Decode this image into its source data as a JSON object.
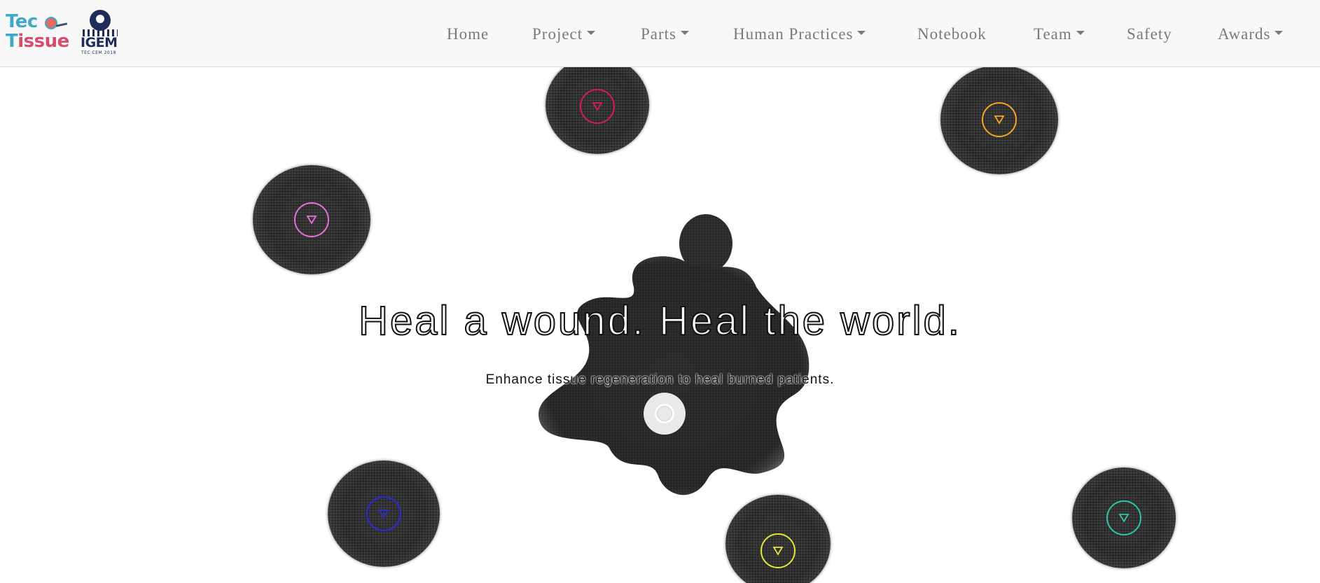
{
  "brand": {
    "teco_line1": "Tec",
    "teco_line2_a": "T",
    "teco_line2_b": "issue",
    "igem_text": "IGEM",
    "igem_sub": "TEC CEM 2018"
  },
  "nav": {
    "items": [
      {
        "label": "Home",
        "dropdown": false
      },
      {
        "label": "Project",
        "dropdown": true
      },
      {
        "label": "Parts",
        "dropdown": true
      },
      {
        "label": "Human Practices",
        "dropdown": true
      },
      {
        "label": "Notebook",
        "dropdown": false
      },
      {
        "label": "Team",
        "dropdown": true
      },
      {
        "label": "Safety",
        "dropdown": false
      },
      {
        "label": "Awards",
        "dropdown": true
      }
    ]
  },
  "hero": {
    "title": "Heal a wound. Heal the world.",
    "subtitle": "Enhance tissue regeneration to heal burned patients."
  },
  "spheres": [
    {
      "name": "sphere-crimson",
      "ring_color": "#d81b60"
    },
    {
      "name": "sphere-orange",
      "ring_color": "#f5a623"
    },
    {
      "name": "sphere-pink",
      "ring_color": "#e573d6"
    },
    {
      "name": "sphere-blue",
      "ring_color": "#2a2ae0"
    },
    {
      "name": "sphere-yellow",
      "ring_color": "#e4e835"
    },
    {
      "name": "sphere-teal",
      "ring_color": "#2ec4a8"
    }
  ],
  "icons": {
    "sphere_marker": "triangle-down-icon",
    "center": "circle-button-icon"
  }
}
